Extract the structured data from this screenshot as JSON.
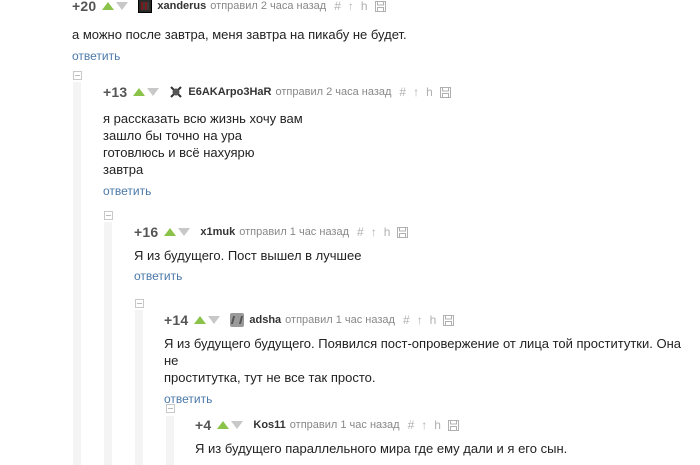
{
  "comments": [
    {
      "rating": "+20",
      "nick": "xanderus",
      "meta": "отправил 2 часа назад",
      "lines": [
        "а можно после завтра, меня завтра на пикабу не будет."
      ],
      "reply": "ответить"
    },
    {
      "rating": "+13",
      "nick": "E6AKArpo3HaR",
      "meta": "отправил 2 часа назад",
      "lines": [
        "я рассказать всю жизнь хочу вам",
        "зашло бы точно на ура",
        "готовлюсь и всё нахуярю",
        "завтра"
      ],
      "reply": "ответить"
    },
    {
      "rating": "+16",
      "nick": "x1muk",
      "meta": "отправил 1 час назад",
      "lines": [
        "Я из будущего. Пост вышел в лучшее"
      ],
      "reply": "ответить"
    },
    {
      "rating": "+14",
      "nick": "adsha",
      "meta": "отправил 1 час назад",
      "lines": [
        "Я из будущего будущего. Появился пост-опровержение от лица той проститутки. Она не",
        "проститутка, тут не все так просто."
      ],
      "reply": "ответить"
    },
    {
      "rating": "+4",
      "nick": "Kos11",
      "meta": "отправил 1 час назад",
      "lines": [
        "Я из будущего параллельного мира где ему дали и я его сын."
      ],
      "reply": ""
    }
  ],
  "colors": {
    "vote_up": "#8bc34a",
    "vote_down": "#c8c8c8",
    "link": "#4a78a8",
    "meta": "#888888"
  },
  "icons": [
    "hash-icon",
    "parent-arrow-icon",
    "branch-icon",
    "save-icon"
  ]
}
